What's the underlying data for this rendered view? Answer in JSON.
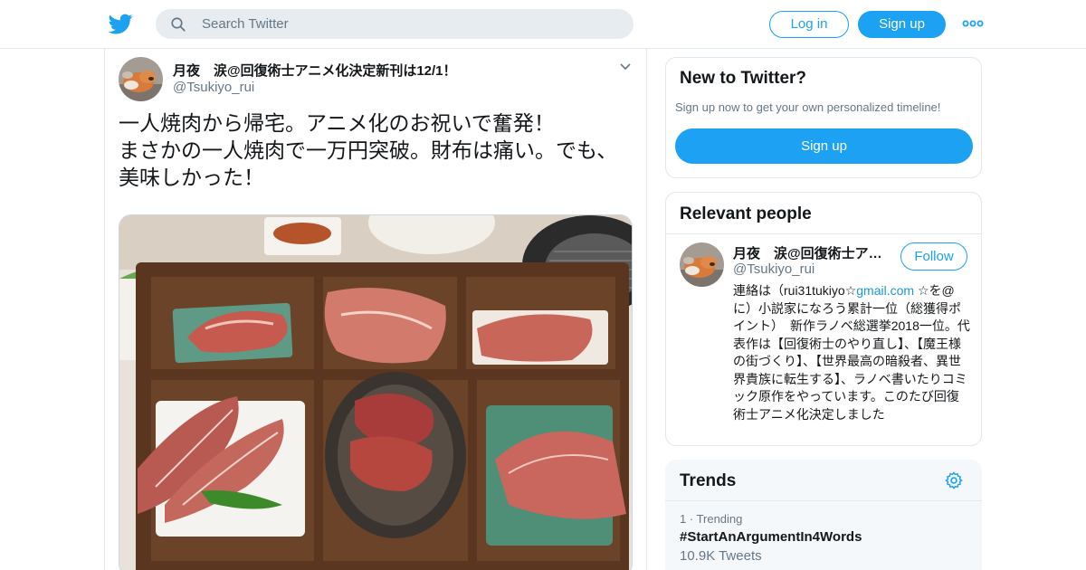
{
  "header": {
    "logo_icon": "twitter-bird-icon",
    "search_placeholder": "Search Twitter",
    "login_label": "Log in",
    "signup_label": "Sign up",
    "more_icon": "more-dots-icon",
    "brand_color": "#1da1f2"
  },
  "tweet": {
    "author_name": "月夜　涙@回復術士アニメ化決定新刊は12/1！",
    "author_handle": "@Tsukiyo_rui",
    "text_lines": [
      "一人焼肉から帰宅。アニメ化のお祝いで奮発！",
      "まさかの一人焼肉で一万円突破。財布は痛い。でも、",
      "美味しかった！"
    ],
    "photo_icon": "yakiniku-photo"
  },
  "new_to_twitter": {
    "title": "New to Twitter?",
    "subtitle": "Sign up now to get your own personalized timeline!",
    "button_label": "Sign up"
  },
  "relevant_people": {
    "title": "Relevant people",
    "name": "月夜　涙@回復術士ア…",
    "handle": "@Tsukiyo_rui",
    "follow_label": "Follow",
    "bio_prefix": "連絡は（rui31tukiyo☆",
    "bio_link": "gmail.com",
    "bio_rest": " ☆を@に）小説家になろう累計一位（総獲得ポイント）　新作ラノベ総選挙2018一位。代表作は【回復術士のやり直し】、【魔王様の街づくり】、【世界最高の暗殺者、異世界貴族に転生する】、ラノベ書いたりコミック原作をやっています。このたび回復術士アニメ化決定しました"
  },
  "trends": {
    "title": "Trends",
    "settings_icon": "gear-icon",
    "items": [
      {
        "rank": "1",
        "meta": "Trending",
        "name": "#StartAnArgumentIn4Words",
        "count": "10.9K Tweets"
      }
    ]
  }
}
